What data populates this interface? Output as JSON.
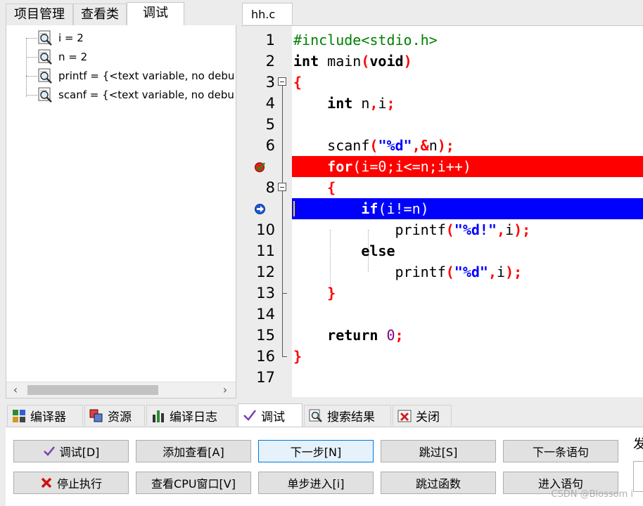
{
  "left_tabs": [
    "项目管理",
    "查看类",
    "调试"
  ],
  "watches": [
    {
      "text": "i = 2"
    },
    {
      "text": "n = 2"
    },
    {
      "text": "printf = {<text variable, no debu"
    },
    {
      "text": "scanf = {<text variable, no debu"
    }
  ],
  "scroll": {
    "left": "‹",
    "right": "›"
  },
  "editor": {
    "tab": "hh.c",
    "breakpoint_line": 7,
    "current_line": 9,
    "lines": [
      {
        "n": "1"
      },
      {
        "n": "2"
      },
      {
        "n": "3"
      },
      {
        "n": "4"
      },
      {
        "n": "5"
      },
      {
        "n": "6"
      },
      {
        "n": ""
      },
      {
        "n": "8"
      },
      {
        "n": ""
      },
      {
        "n": "10"
      },
      {
        "n": "11"
      },
      {
        "n": "12"
      },
      {
        "n": "13"
      },
      {
        "n": "14"
      },
      {
        "n": "15"
      },
      {
        "n": "16"
      },
      {
        "n": "17"
      }
    ],
    "code": {
      "l1": "#include<stdio.h>",
      "l2a": "int",
      "l2b": " main",
      "l2c": "(",
      "l2d": "void",
      "l2e": ")",
      "l3": "{",
      "l4a": "int",
      "l4b": " n",
      "l4c": ",",
      "l4d": "i",
      "l4e": ";",
      "l6a": "scanf",
      "l6b": "(",
      "l6c": "\"%d\"",
      "l6d": ",&",
      "l6e": "n",
      "l6f": ");",
      "l7a": "for",
      "l7b": "(i=0;i<=n;i++)",
      "l8": "{",
      "l9a": "if",
      "l9b": "(i!=n)",
      "l10a": "printf",
      "l10b": "(",
      "l10c": "\"%d!\"",
      "l10d": ",",
      "l10e": "i",
      "l10f": ");",
      "l11": "else",
      "l12a": "printf",
      "l12b": "(",
      "l12c": "\"%d\"",
      "l12d": ",",
      "l12e": "i",
      "l12f": ");",
      "l13": "}",
      "l15a": "return",
      "l15b": "0",
      "l15c": ";",
      "l16": "}"
    }
  },
  "bottom_tabs": [
    "编译器",
    "资源",
    "编译日志",
    "调试",
    "搜索结果",
    "关闭"
  ],
  "buttons": {
    "debug": "调试[D]",
    "add_watch": "添加查看[A]",
    "next_step": "下一步[N]",
    "skip": "跳过[S]",
    "next_statement": "下一条语句",
    "stop": "停止执行",
    "view_cpu": "查看CPU窗口[V]",
    "step_into": "单步进入[i]",
    "skip_function": "跳过函数",
    "enter_statement": "进入语句"
  },
  "side_label": "发",
  "watermark": "CSDN @Blossom i",
  "colors": {
    "breakpoint": "#ff0000",
    "current": "#0000ff",
    "keyword_string": "#0000ff",
    "symbol": "#ff0000",
    "preprocessor": "#008000"
  }
}
